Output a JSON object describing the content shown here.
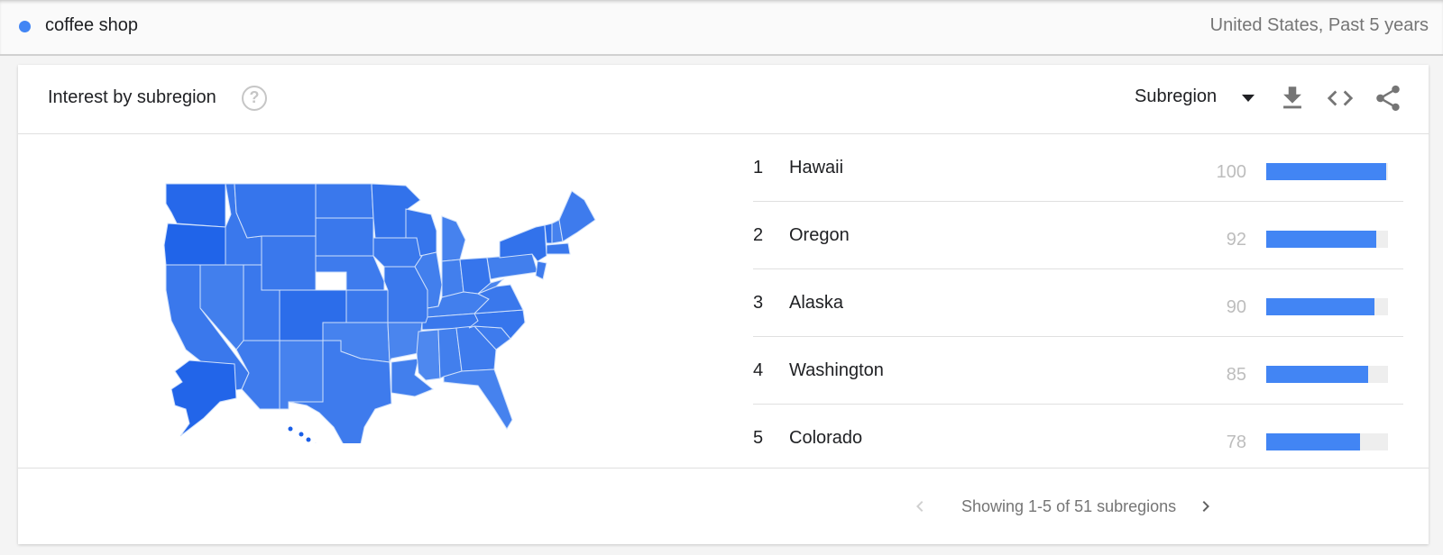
{
  "header": {
    "term": "coffee shop",
    "term_color": "#4285f4",
    "scope": "United States, Past 5 years"
  },
  "card": {
    "title": "Interest by subregion",
    "help_icon": "help-circle-icon",
    "resolution_select": "Subregion",
    "actions": [
      {
        "name": "download",
        "icon": "download-icon"
      },
      {
        "name": "embed",
        "icon": "code-icon"
      },
      {
        "name": "share",
        "icon": "share-icon"
      }
    ]
  },
  "ranking": [
    {
      "rank": "1",
      "region": "Hawaii",
      "value": "100",
      "fraction": 1.0
    },
    {
      "rank": "2",
      "region": "Oregon",
      "value": "92",
      "fraction": 0.92
    },
    {
      "rank": "3",
      "region": "Alaska",
      "value": "90",
      "fraction": 0.9
    },
    {
      "rank": "4",
      "region": "Washington",
      "value": "85",
      "fraction": 0.85
    },
    {
      "rank": "5",
      "region": "Colorado",
      "value": "78",
      "fraction": 0.78
    }
  ],
  "pager": {
    "text": "Showing 1-5 of 51 subregions",
    "prev_icon": "chevron-left-icon",
    "next_icon": "chevron-right-icon"
  },
  "colors": {
    "accent": "#4285f4",
    "bar_track": "#eeeeee",
    "map_high": "#1a5fe8",
    "map_low": "#6a9ef2"
  },
  "map": {
    "type": "choropleth",
    "region": "United States",
    "states": [
      {
        "id": "WA",
        "level": 0.85
      },
      {
        "id": "OR",
        "level": 0.92
      },
      {
        "id": "CA",
        "level": 0.6
      },
      {
        "id": "ID",
        "level": 0.6
      },
      {
        "id": "NV",
        "level": 0.5
      },
      {
        "id": "MT",
        "level": 0.65
      },
      {
        "id": "WY",
        "level": 0.6
      },
      {
        "id": "UT",
        "level": 0.6
      },
      {
        "id": "AZ",
        "level": 0.55
      },
      {
        "id": "CO",
        "level": 0.78
      },
      {
        "id": "NM",
        "level": 0.45
      },
      {
        "id": "ND",
        "level": 0.6
      },
      {
        "id": "SD",
        "level": 0.6
      },
      {
        "id": "NE",
        "level": 0.55
      },
      {
        "id": "KS",
        "level": 0.6
      },
      {
        "id": "OK",
        "level": 0.45
      },
      {
        "id": "TX",
        "level": 0.55
      },
      {
        "id": "MN",
        "level": 0.7
      },
      {
        "id": "IA",
        "level": 0.6
      },
      {
        "id": "MO",
        "level": 0.6
      },
      {
        "id": "AR",
        "level": 0.4
      },
      {
        "id": "LA",
        "level": 0.5
      },
      {
        "id": "WI",
        "level": 0.65
      },
      {
        "id": "IL",
        "level": 0.5
      },
      {
        "id": "MI",
        "level": 0.45
      },
      {
        "id": "IN",
        "level": 0.5
      },
      {
        "id": "OH",
        "level": 0.65
      },
      {
        "id": "KY",
        "level": 0.5
      },
      {
        "id": "TN",
        "level": 0.6
      },
      {
        "id": "MS",
        "level": 0.35
      },
      {
        "id": "AL",
        "level": 0.5
      },
      {
        "id": "GA",
        "level": 0.55
      },
      {
        "id": "FL",
        "level": 0.45
      },
      {
        "id": "SC",
        "level": 0.55
      },
      {
        "id": "NC",
        "level": 0.65
      },
      {
        "id": "VA",
        "level": 0.6
      },
      {
        "id": "WV",
        "level": 0.4
      },
      {
        "id": "PA",
        "level": 0.5
      },
      {
        "id": "NY",
        "level": 0.7
      },
      {
        "id": "VT",
        "level": 0.75
      },
      {
        "id": "NH",
        "level": 0.45
      },
      {
        "id": "ME",
        "level": 0.55
      },
      {
        "id": "MA",
        "level": 0.6
      },
      {
        "id": "NJ",
        "level": 0.55
      },
      {
        "id": "AK",
        "level": 0.9
      },
      {
        "id": "HI",
        "level": 1.0
      }
    ]
  }
}
